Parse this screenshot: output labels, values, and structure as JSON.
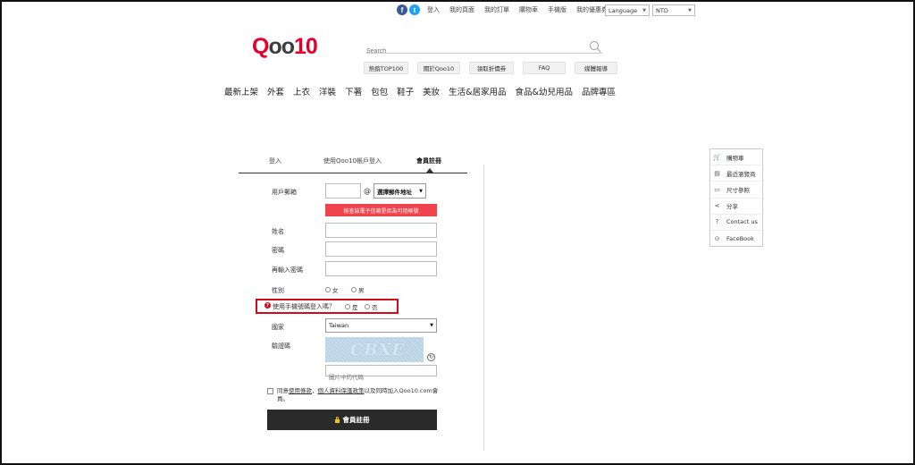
{
  "topbar": {
    "links": [
      "登入",
      "我的頁面",
      "我的訂單",
      "購物車",
      "手機版",
      "我的優惠券"
    ],
    "language_label": "Language",
    "currency_label": "NTD"
  },
  "logo": {
    "q": "Q",
    "oo": "oo",
    "ten": "10"
  },
  "search": {
    "placeholder": "Search"
  },
  "quick_links": [
    "熱銷TOP100",
    "關於Qoo10",
    "領取折價券",
    "FAQ",
    "媒體報導"
  ],
  "categories": [
    "最新上架",
    "外套",
    "上衣",
    "洋裝",
    "下著",
    "包包",
    "鞋子",
    "美妝",
    "生活&居家用品",
    "食品&幼兒用品",
    "品牌專區"
  ],
  "tabs": [
    "登入",
    "使用Qoo10帳戶登入",
    "會員註冊"
  ],
  "form": {
    "email_label": "用戶郵箱",
    "at": "@",
    "email_domain": "選擇郵件地址",
    "check_email_button": "檢查該電子信箱是否為可用帳號",
    "name_label": "姓名",
    "password_label": "密碼",
    "password_confirm_label": "再輸入密碼",
    "gender_label": "性別",
    "gender_female": "女",
    "gender_male": "男",
    "phone_login_label": "使用手機號碼登入嗎？",
    "phone_yes": "是",
    "phone_no": "否",
    "country_label": "國家",
    "country_value": "Taiwan",
    "captcha_label": "驗證碼",
    "captcha_text": "CBXE",
    "captcha_placeholder": "圖片中的代碼",
    "agree_prefix": "同意",
    "agree_terms": "使用條款",
    "agree_sep": "，",
    "agree_privacy": "個人資料保護政策",
    "agree_suffix": "以及同時加入Qoo10.com會員。",
    "submit_label": "會員註冊"
  },
  "sidebar": [
    "購物車",
    "最近瀏覽商",
    "尺寸參照",
    "分享",
    "Contact us",
    "FaceBook"
  ],
  "colors": {
    "brand_red": "#e4002b",
    "alert_red": "#f0434d",
    "highlight_frame": "#d10a1e",
    "submit_bg": "#2a2a2a"
  }
}
